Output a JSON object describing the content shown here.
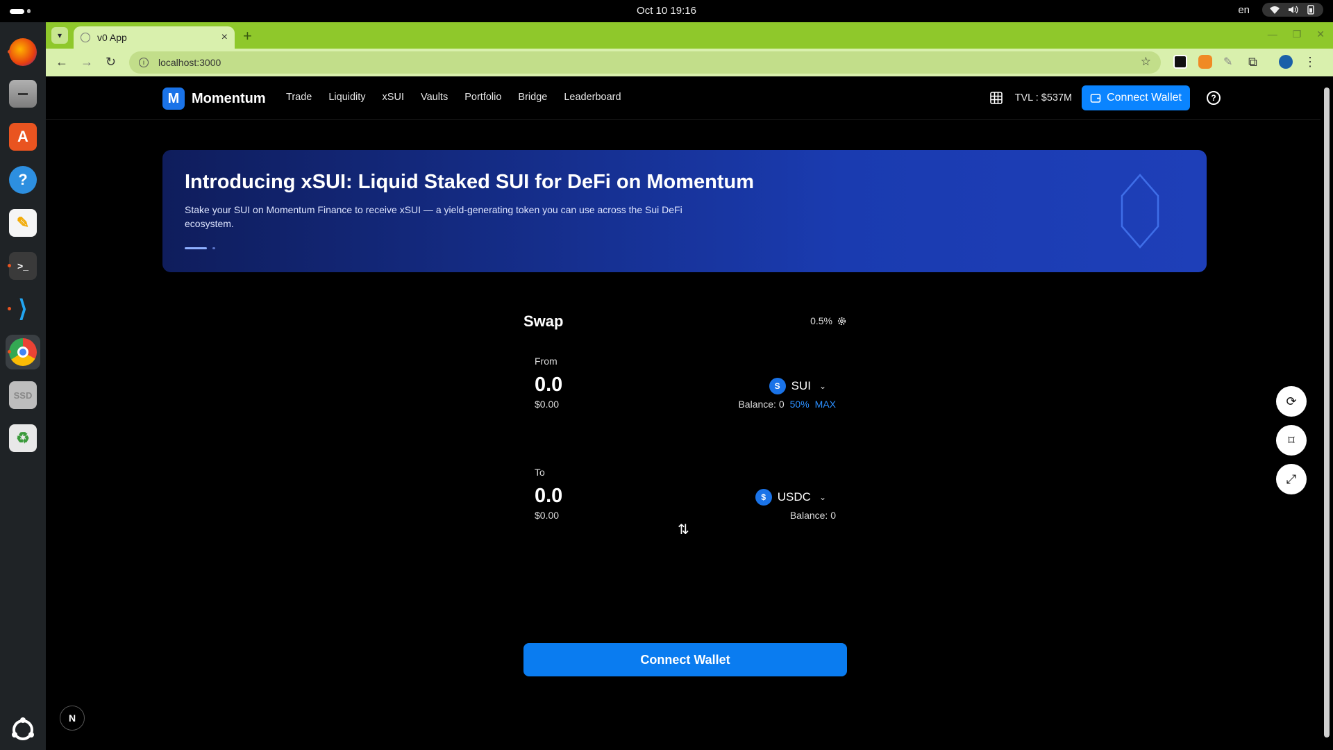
{
  "system": {
    "clock": "Oct 10  19:16",
    "language": "en"
  },
  "dock": {
    "items": [
      {
        "name": "firefox",
        "icon": "firefox-icon"
      },
      {
        "name": "files",
        "icon": "folder-icon"
      },
      {
        "name": "app-center",
        "icon": "app-store-icon"
      },
      {
        "name": "help",
        "icon": "help-icon",
        "glyph": "?"
      },
      {
        "name": "text-editor",
        "icon": "text-editor-icon"
      },
      {
        "name": "terminal",
        "icon": "terminal-icon",
        "glyph": ">_"
      },
      {
        "name": "vscode",
        "icon": "vscode-icon"
      },
      {
        "name": "chrome",
        "icon": "chrome-icon"
      },
      {
        "name": "ssd",
        "icon": "drive-icon",
        "glyph": "SSD"
      },
      {
        "name": "trash",
        "icon": "trash-icon",
        "glyph": "♻"
      },
      {
        "name": "show-apps",
        "icon": "ubuntu-apps-icon"
      }
    ]
  },
  "browser": {
    "tab_title": "v0 App",
    "url": "localhost:3000"
  },
  "app": {
    "brand_letter": "M",
    "brand_name": "Momentum",
    "nav": [
      "Trade",
      "Liquidity",
      "xSUI",
      "Vaults",
      "Portfolio",
      "Bridge",
      "Leaderboard"
    ],
    "tvl": "TVL : $537M",
    "connect_wallet": "Connect Wallet",
    "accent": "#0a84ff"
  },
  "banner": {
    "title": "Introducing xSUI: Liquid Staked SUI for DeFi on Momentum",
    "text": "Stake your SUI on Momentum Finance to receive xSUI — a yield-generating token you can use across the Sui DeFi ecosystem."
  },
  "swap": {
    "title": "Swap",
    "slippage": "0.5%",
    "from": {
      "label": "From",
      "amount": "0.0",
      "usd": "$0.00",
      "token": "SUI",
      "coin_glyph": "S",
      "balance": "Balance: 0",
      "half": "50%",
      "max": "MAX"
    },
    "to": {
      "label": "To",
      "amount": "0.0",
      "usd": "$0.00",
      "token": "USDC",
      "coin_glyph": "$",
      "balance": "Balance: 0"
    },
    "button": "Connect Wallet"
  },
  "badge": "N"
}
